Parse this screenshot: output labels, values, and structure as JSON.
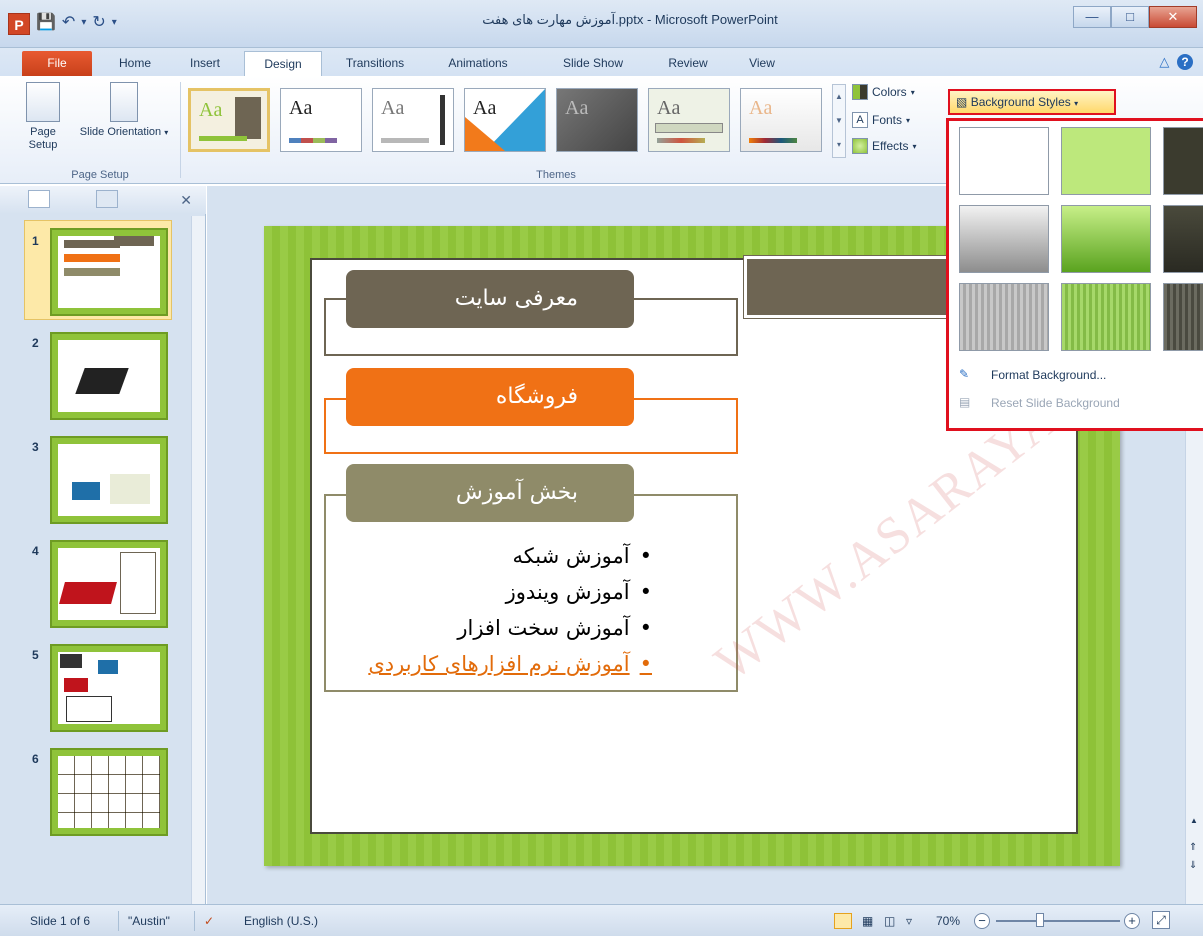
{
  "window": {
    "title": "آموزش مهارت های هفت.pptx - Microsoft PowerPoint",
    "app_icon_letter": "P"
  },
  "tabs": {
    "file": "File",
    "items": [
      "Home",
      "Insert",
      "Design",
      "Transitions",
      "Animations",
      "Slide Show",
      "Review",
      "View"
    ],
    "active": "Design"
  },
  "ribbon": {
    "page_setup": {
      "page_setup_label": "Page Setup",
      "slide_orientation_label": "Slide Orientation",
      "group_label": "Page Setup"
    },
    "themes": {
      "group_label": "Themes",
      "thumb_text": "Aa"
    },
    "colors_label": "Colors",
    "fonts_label": "Fonts",
    "effects_label": "Effects",
    "background_styles_label": "Background Styles"
  },
  "background_menu": {
    "format_background": "Format Background...",
    "reset_background": "Reset Slide Background",
    "swatches": [
      {
        "style": "white"
      },
      {
        "style": "light-green"
      },
      {
        "style": "dark-olive"
      },
      {
        "style": "gray-gradient"
      },
      {
        "style": "green-gradient"
      },
      {
        "style": "dark-gradient"
      },
      {
        "style": "gray-stripes"
      },
      {
        "style": "green-stripes"
      },
      {
        "style": "dark-stripes"
      }
    ]
  },
  "slides_panel": {
    "slides": [
      {
        "number": "1",
        "selected": true
      },
      {
        "number": "2",
        "selected": false
      },
      {
        "number": "3",
        "selected": false
      },
      {
        "number": "4",
        "selected": false
      },
      {
        "number": "5",
        "selected": false
      },
      {
        "number": "6",
        "selected": false
      }
    ]
  },
  "slide": {
    "section1": "معرفی سایت",
    "section2": "فروشگاه",
    "section3": "بخش آموزش",
    "bullets": [
      "آموزش شبکه",
      "آموزش ویندوز",
      "آموزش سخت افزار",
      "آموزش نرم افزارهای کاربردی"
    ],
    "watermark": "WWW.ASARAYAN.COM"
  },
  "status": {
    "slide_count": "Slide 1 of 6",
    "theme": "\"Austin\"",
    "language": "English (U.S.)",
    "zoom": "70%"
  },
  "colors": {
    "accent_green": "#93c83a",
    "section_brown": "#6e6553",
    "section_orange": "#f07115",
    "section_olive": "#8f8b69",
    "highlight_red": "#e0101e"
  }
}
